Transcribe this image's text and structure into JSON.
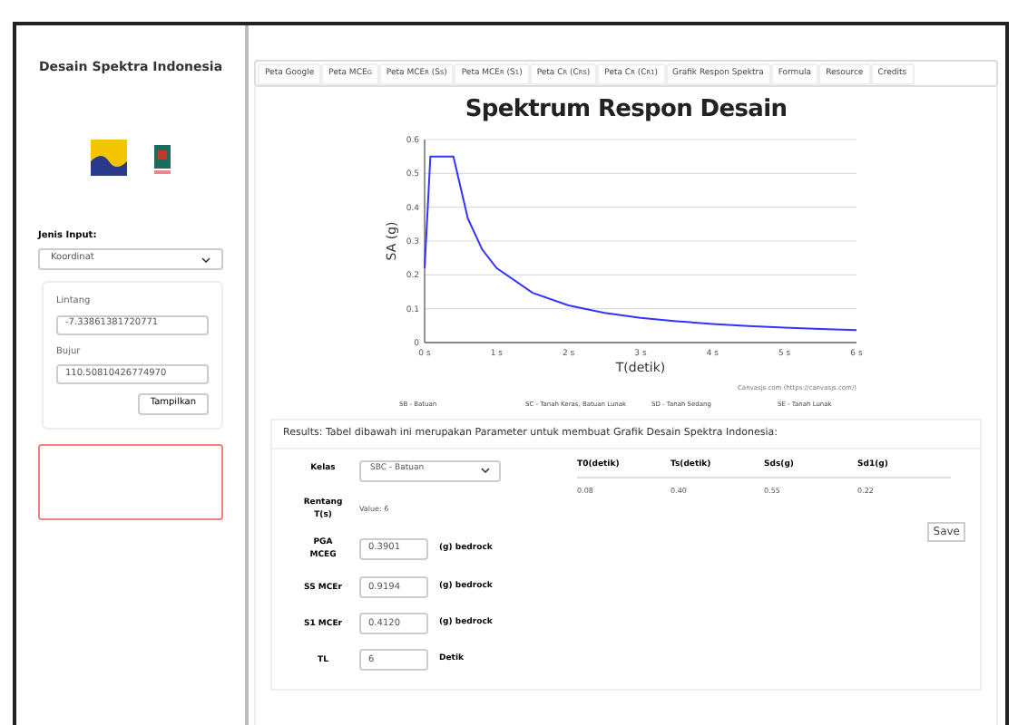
{
  "sidebar": {
    "title": "Desain Spektra Indonesia",
    "input_label": "Jenis Input:",
    "input_type": "Koordinat",
    "lat_label": "Lintang",
    "lat_value": "-7.33861381720771",
    "lon_label": "Bujur",
    "lon_value": "110.50810426774970",
    "submit": "Tampilkan"
  },
  "tabs": [
    {
      "label": "Peta Google",
      "selected": false
    },
    {
      "label": "Peta MCE$_{G}$",
      "selected": false
    },
    {
      "label": "Peta MCE$_{R}$ (S$_{S}$)",
      "selected": false
    },
    {
      "label": "Peta MCE$_{R}$ (S$_{1}$)",
      "selected": false
    },
    {
      "label": "Peta C$_{R}$ (C$_{RS}$)",
      "selected": false
    },
    {
      "label": "Peta C$_{R}$ (C$_{R1}$)",
      "selected": false
    },
    {
      "label": "Grafik Respon Spektra",
      "selected": false
    },
    {
      "label": "Formula",
      "selected": false
    },
    {
      "label": "Resource",
      "selected": false
    },
    {
      "label": "Credits",
      "selected": false
    }
  ],
  "chart": {
    "credit": "Canvasjs.com (https://canvasjs.com/)",
    "chart_data": {
      "type": "line",
      "title": "Spektrum Respon Desain",
      "xlabel": "T(detik)",
      "ylabel": "SA (g)",
      "x": [
        0,
        0.08,
        0.4,
        0.6,
        0.8,
        1,
        1.5,
        2,
        2.5,
        3,
        3.5,
        4,
        4.5,
        5,
        5.5,
        6
      ],
      "grid": true,
      "series": [
        {
          "color": "#3333ff",
          "values": [
            0.22,
            0.55,
            0.55,
            0.367,
            0.275,
            0.22,
            0.147,
            0.11,
            0.088,
            0.073,
            0.063,
            0.055,
            0.049,
            0.044,
            0.04,
            0.037
          ]
        }
      ],
      "xlim": [
        0,
        6
      ],
      "ylim": [
        0,
        0.6
      ],
      "xticks": [
        {
          "value": 0,
          "label": "0 s"
        },
        {
          "value": 1,
          "label": "1 s"
        },
        {
          "value": 2,
          "label": "2 s"
        },
        {
          "value": 3,
          "label": "3 s"
        },
        {
          "value": 4,
          "label": "4 s"
        },
        {
          "value": 5,
          "label": "5 s"
        },
        {
          "value": 6,
          "label": "6 s"
        }
      ],
      "yticks": [
        0,
        0.1,
        0.2,
        0.3,
        0.4,
        0.5,
        0.6
      ]
    }
  },
  "legend": [
    "SB - Batuan",
    "SC - Tanah Keras, Batuan Lunak",
    "SD - Tanah Sedang",
    "SE - Tanah Lunak"
  ],
  "results": {
    "heading": "Results: Tabel dibawah ini merupakan Parameter untuk membuat Grafik Desain Spektra Indonesia:",
    "kelas_label": "Kelas",
    "kelas_value": "SBC - Batuan",
    "columns": [
      "T0(detik)",
      "Ts(detik)",
      "Sds(g)",
      "Sd1(g)"
    ],
    "values": [
      "0.08",
      "0.40",
      "0.55",
      "0.22"
    ],
    "range_label": "Rentang T(s)",
    "range_value": "Value: 6",
    "params": [
      {
        "label": "PGA MCEG",
        "value": "0.3901",
        "unit": "(g) bedrock"
      },
      {
        "label": "SS MCEr",
        "value": "0.9194",
        "unit": "(g) bedrock"
      },
      {
        "label": "S1 MCEr",
        "value": "0.4120",
        "unit": "(g) bedrock"
      },
      {
        "label": "TL",
        "value": "6",
        "unit": "Detik"
      }
    ],
    "save": "Save"
  }
}
